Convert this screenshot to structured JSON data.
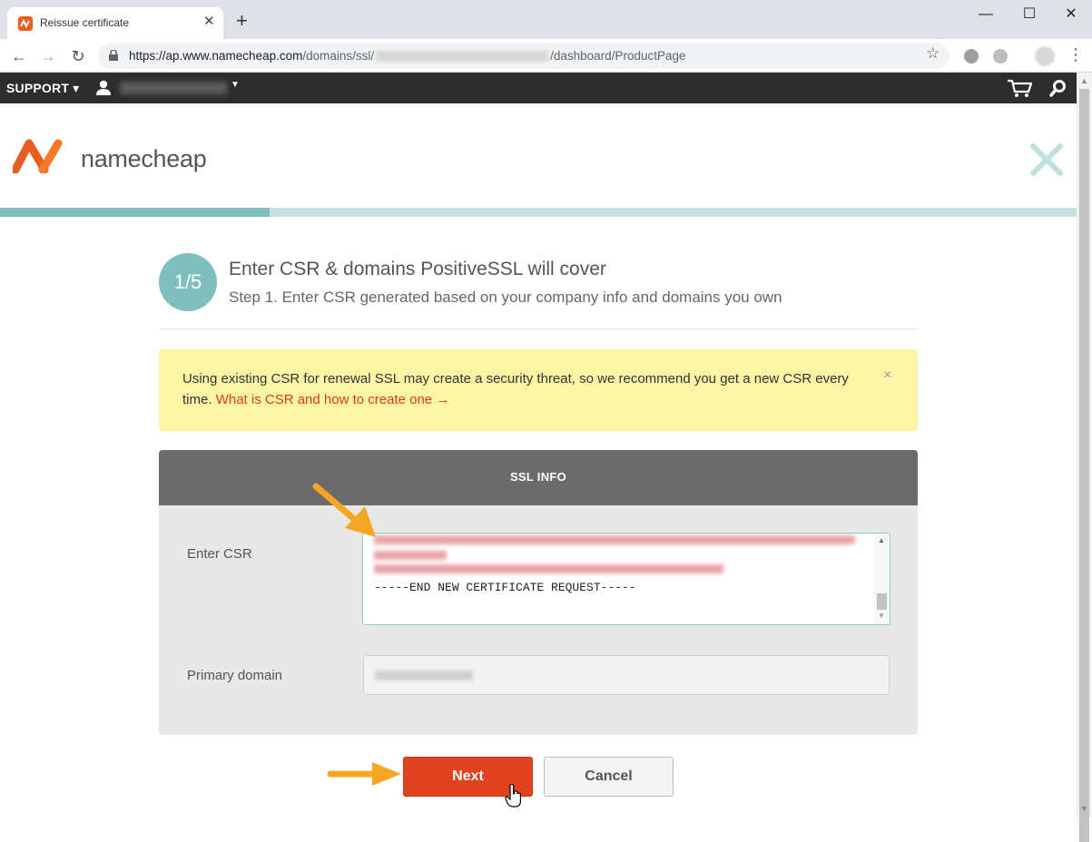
{
  "browser": {
    "tab_title": "Reissue certificate",
    "new_tab": "+",
    "url_host": "https://ap.www.namecheap.com",
    "url_path_start": "/domains/ssl/",
    "url_path_end": "/dashboard/ProductPage",
    "window_controls": {
      "minimize": "—",
      "maximize": "☐",
      "close": "✕"
    }
  },
  "topbar": {
    "support_label": "SUPPORT",
    "icons": [
      "user-icon",
      "cart-icon",
      "search-icon"
    ]
  },
  "header": {
    "logo_text": "namecheap",
    "brand_color": "#e85d22"
  },
  "progress": {
    "step": 1,
    "total": 5,
    "fraction": 0.25
  },
  "step": {
    "badge": "1/5",
    "title": "Enter CSR & domains PositiveSSL will cover",
    "subtitle": "Step 1. Enter CSR generated based on your company info and domains you own"
  },
  "alert": {
    "text": "Using existing CSR for renewal SSL may create a security threat, so we recommend you get a new CSR every time.",
    "link_text": "What is CSR and how to create one →",
    "close": "×"
  },
  "panel": {
    "title": "SSL INFO",
    "csr_label": "Enter CSR",
    "csr_end_line": "-----END NEW CERTIFICATE REQUEST-----",
    "domain_label": "Primary domain"
  },
  "actions": {
    "next_label": "Next",
    "cancel_label": "Cancel"
  },
  "colors": {
    "accent_teal": "#7fbfbd",
    "next_button": "#e0411f",
    "alert_bg": "#fbf5a6",
    "annotation_arrow": "#f5a623"
  }
}
